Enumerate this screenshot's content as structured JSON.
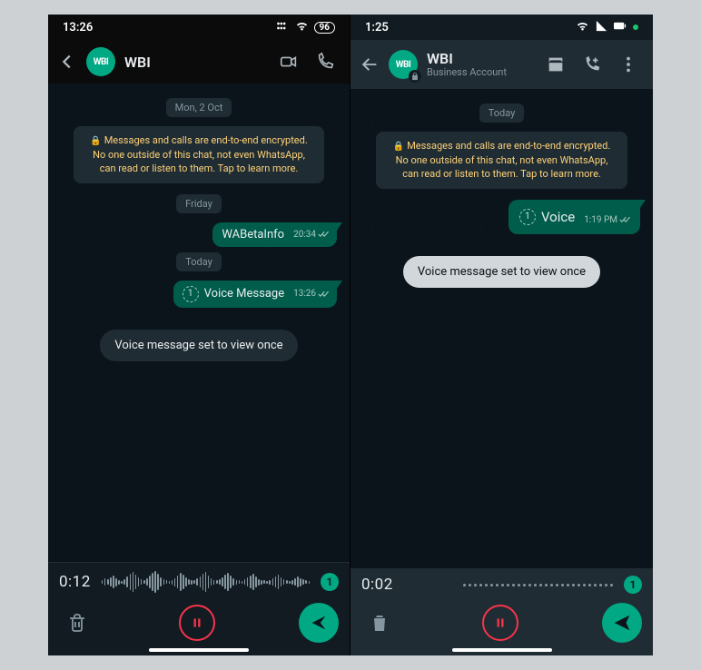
{
  "left": {
    "status": {
      "time": "13:26",
      "battery": "96"
    },
    "header": {
      "title": "WBI"
    },
    "dates": {
      "d1": "Mon, 2 Oct",
      "d2": "Friday",
      "d3": "Today"
    },
    "encryption": "Messages and calls are end-to-end encrypted. No one outside of this chat, not even WhatsApp, can read or listen to them. Tap to learn more.",
    "msg1": {
      "text": "WABetaInfo",
      "time": "20:34"
    },
    "msg2": {
      "text": "Voice Message",
      "time": "13:26"
    },
    "toast": "Voice message set to view once",
    "record": {
      "time": "0:12",
      "unread": "1"
    }
  },
  "right": {
    "status": {
      "time": "1:25"
    },
    "header": {
      "title": "WBI",
      "subtitle": "Business Account"
    },
    "dates": {
      "d1": "Today"
    },
    "encryption": "Messages and calls are end-to-end encrypted. No one outside of this chat, not even WhatsApp, can read or listen to them. Tap to learn more.",
    "msg1": {
      "text": "Voice",
      "time": "1:19 PM"
    },
    "toast": "Voice message set to view once",
    "record": {
      "time": "0:02",
      "unread": "1"
    }
  },
  "avatar": "WBI"
}
